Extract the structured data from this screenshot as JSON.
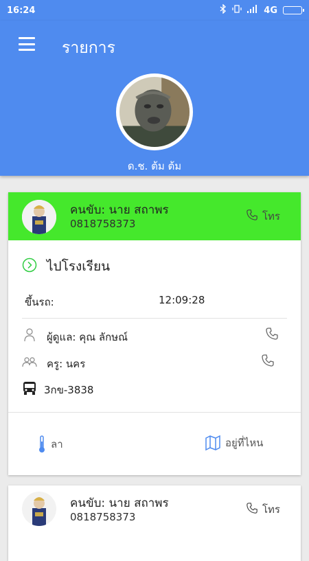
{
  "status_bar": {
    "time": "16:24",
    "network": "4G"
  },
  "header": {
    "title": "รายการ",
    "profile_name": "ด.ช. ต้ม ต้ม"
  },
  "cards": [
    {
      "driver_label": "คนขับ: นาย สถาพร",
      "driver_phone": "0818758373",
      "call_label": "โทร",
      "status": "ไปโรงเรียน",
      "pickup_label": "ขึ้นรถ:",
      "pickup_time": "12:09:28",
      "guardian": "ผู้ดูแล: คุณ ลักษณ์",
      "teacher": "ครู: นคร",
      "bus_plate": "3กข-3838",
      "leave_label": "ลา",
      "where_label": "อยู่ที่ไหน",
      "header_color": "#45e82c"
    },
    {
      "driver_label": "คนขับ: นาย สถาพร",
      "driver_phone": "0818758373",
      "call_label": "โทร"
    }
  ],
  "colors": {
    "primary": "#4f8bef",
    "active_card": "#45e82c",
    "accent_green": "#2ecc40",
    "icon_blue": "#4f8bef"
  }
}
